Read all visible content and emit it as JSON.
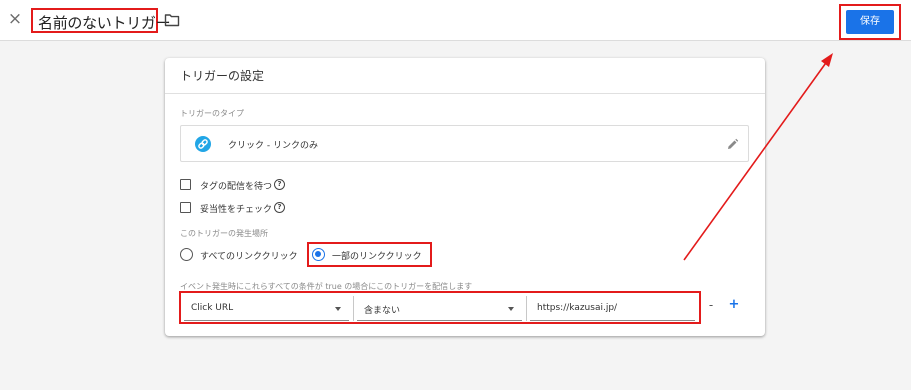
{
  "header": {
    "close_glyph": "×",
    "title": "名前のないトリガー",
    "save_label": "保存"
  },
  "card": {
    "title": "トリガーの設定",
    "type_section_label": "トリガーのタイプ",
    "trigger_type": "クリック - リンクのみ",
    "checkboxes": [
      {
        "label": "タグの配信を待つ",
        "checked": false
      },
      {
        "label": "妥当性をチェック",
        "checked": false
      }
    ],
    "fire_on_label": "このトリガーの発生場所",
    "radio_options": [
      {
        "label": "すべてのリンククリック",
        "selected": false
      },
      {
        "label": "一部のリンククリック",
        "selected": true
      }
    ],
    "condition_label": "イベント発生時にこれらすべての条件が true の場合にこのトリガーを配信します",
    "condition": {
      "variable": "Click URL",
      "operator": "含まない",
      "value": "https://kazusai.jp/"
    },
    "remove_glyph": "-",
    "add_glyph": "+"
  },
  "colors": {
    "accent": "#1a73e8",
    "highlight_red": "#e31b1b",
    "link_icon": "#22a6e6"
  },
  "icons": [
    "close-icon",
    "folder-icon",
    "link-icon",
    "pencil-icon",
    "help-icon",
    "dropdown-caret-icon"
  ]
}
